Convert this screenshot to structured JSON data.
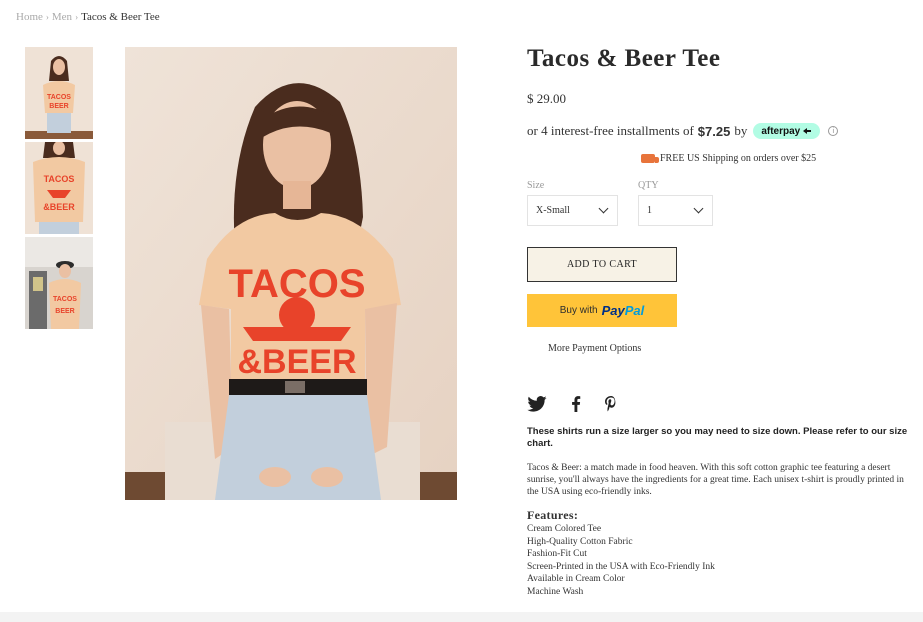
{
  "breadcrumb": {
    "home": "Home",
    "men": "Men",
    "current": "Tacos & Beer Tee"
  },
  "product": {
    "title": "Tacos & Beer Tee",
    "price": "$ 29.00",
    "installments_prefix": "or 4 interest-free installments of",
    "installment_amount": "$7.25",
    "installments_by": "by",
    "afterpay_label": "afterpay",
    "shipping": "FREE US Shipping on orders over $25",
    "size_label": "Size",
    "size_value": "X-Small",
    "qty_label": "QTY",
    "qty_value": "1",
    "add_to_cart": "ADD TO CART",
    "paypal_prefix": "Buy with",
    "paypal_pay": "Pay",
    "paypal_pal": "Pal",
    "more_payment": "More Payment Options",
    "size_note": "These shirts run a size larger so you may need to size down. Please refer to our size chart.",
    "description": "Tacos & Beer: a match made in food heaven. With this soft cotton graphic tee featuring a desert sunrise, you'll always have the ingredients for a great time. Each unisex t-shirt is proudly printed in the USA using eco-friendly inks.",
    "features_heading": "Features:",
    "features": [
      "Cream Colored Tee",
      "High-Quality Cotton Fabric",
      "Fashion-Fit Cut",
      "Screen-Printed in the USA with Eco-Friendly Ink",
      "Available in Cream Color",
      "Machine Wash"
    ]
  },
  "icons": {
    "social": [
      "twitter-icon",
      "facebook-icon",
      "pinterest-icon"
    ]
  },
  "colors": {
    "afterpay_mint": "#b2fce4",
    "paypal_yellow": "#ffc439",
    "cart_bg": "#f7f2e6",
    "shirt_print": "#e8432a",
    "shirt_color": "#f2c9a2"
  }
}
